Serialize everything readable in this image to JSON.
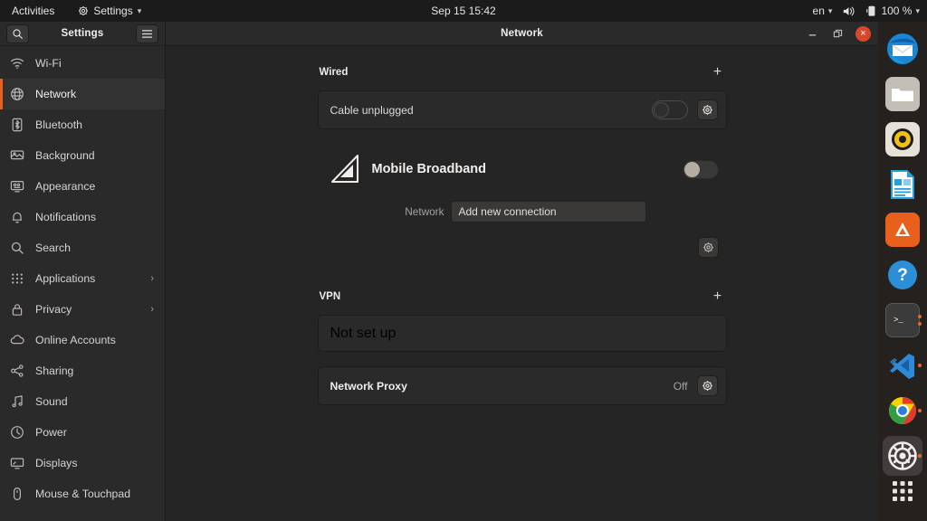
{
  "topbar": {
    "activities": "Activities",
    "app_menu": "Settings",
    "app_menu_icon": "gear-icon",
    "clock": "Sep 15  15:42",
    "keyboard_layout": "en",
    "volume_icon": "speaker-icon",
    "battery_icon": "battery-charging-icon",
    "battery_level": "100 %",
    "chevron": "⌄"
  },
  "sidebar": {
    "title": "Settings",
    "search_icon": "search-icon",
    "menu_icon": "hamburger-menu-icon",
    "items": [
      {
        "label": "Wi-Fi",
        "icon": "wifi-icon",
        "active": false,
        "submenu": false
      },
      {
        "label": "Network",
        "icon": "globe-icon",
        "active": true,
        "submenu": false
      },
      {
        "label": "Bluetooth",
        "icon": "bluetooth-icon",
        "active": false,
        "submenu": false
      },
      {
        "label": "Background",
        "icon": "background-icon",
        "active": false,
        "submenu": false
      },
      {
        "label": "Appearance",
        "icon": "appearance-icon",
        "active": false,
        "submenu": false
      },
      {
        "label": "Notifications",
        "icon": "bell-icon",
        "active": false,
        "submenu": false
      },
      {
        "label": "Search",
        "icon": "search-icon",
        "active": false,
        "submenu": false
      },
      {
        "label": "Applications",
        "icon": "apps-grid-icon",
        "active": false,
        "submenu": true
      },
      {
        "label": "Privacy",
        "icon": "lock-icon",
        "active": false,
        "submenu": true
      },
      {
        "label": "Online Accounts",
        "icon": "cloud-icon",
        "active": false,
        "submenu": false
      },
      {
        "label": "Sharing",
        "icon": "share-icon",
        "active": false,
        "submenu": false
      },
      {
        "label": "Sound",
        "icon": "music-note-icon",
        "active": false,
        "submenu": false
      },
      {
        "label": "Power",
        "icon": "power-icon",
        "active": false,
        "submenu": false
      },
      {
        "label": "Displays",
        "icon": "display-icon",
        "active": false,
        "submenu": false
      },
      {
        "label": "Mouse & Touchpad",
        "icon": "mouse-icon",
        "active": false,
        "submenu": false
      }
    ],
    "submenu_arrow": "›"
  },
  "window": {
    "title": "Network",
    "minimize_label": "—",
    "maximize_label": "❐",
    "close_label": "×"
  },
  "network": {
    "wired": {
      "section_title": "Wired",
      "add_label": "+",
      "row_label": "Cable unplugged",
      "toggle_state": "off",
      "settings_icon": "gear-icon"
    },
    "mobile_broadband": {
      "title": "Mobile Broadband",
      "icon": "cellular-signal-icon",
      "toggle_state": "off",
      "network_label": "Network",
      "connection_value": "Add new connection",
      "settings_icon": "gear-icon"
    },
    "vpn": {
      "section_title": "VPN",
      "add_label": "+",
      "row_label": "Not set up"
    },
    "proxy": {
      "label": "Network Proxy",
      "status": "Off",
      "settings_icon": "gear-icon"
    }
  },
  "dock": {
    "items": [
      {
        "name": "thunderbird",
        "icon": "thunderbird-icon",
        "running": false
      },
      {
        "name": "files",
        "icon": "files-folder-icon",
        "running": false
      },
      {
        "name": "rhythmbox",
        "icon": "rhythmbox-icon",
        "running": false
      },
      {
        "name": "libreoffice",
        "icon": "libreoffice-impress-icon",
        "running": false
      },
      {
        "name": "ubuntu-software",
        "icon": "ubuntu-software-icon",
        "running": false
      },
      {
        "name": "help",
        "icon": "help-icon",
        "running": false
      },
      {
        "name": "terminal",
        "icon": "terminal-icon",
        "running": true
      },
      {
        "name": "vscode",
        "icon": "vscode-icon",
        "running": true
      },
      {
        "name": "chrome",
        "icon": "chrome-icon",
        "running": true
      },
      {
        "name": "settings",
        "icon": "settings-gear-icon",
        "running": true
      }
    ],
    "show_apps": "show-applications-icon"
  },
  "colors": {
    "accent": "#e8601c",
    "close_button": "#d7482a",
    "running_dot": "#e9662a",
    "panel_bg": "#252525",
    "card_bg": "#2b2a2a"
  }
}
